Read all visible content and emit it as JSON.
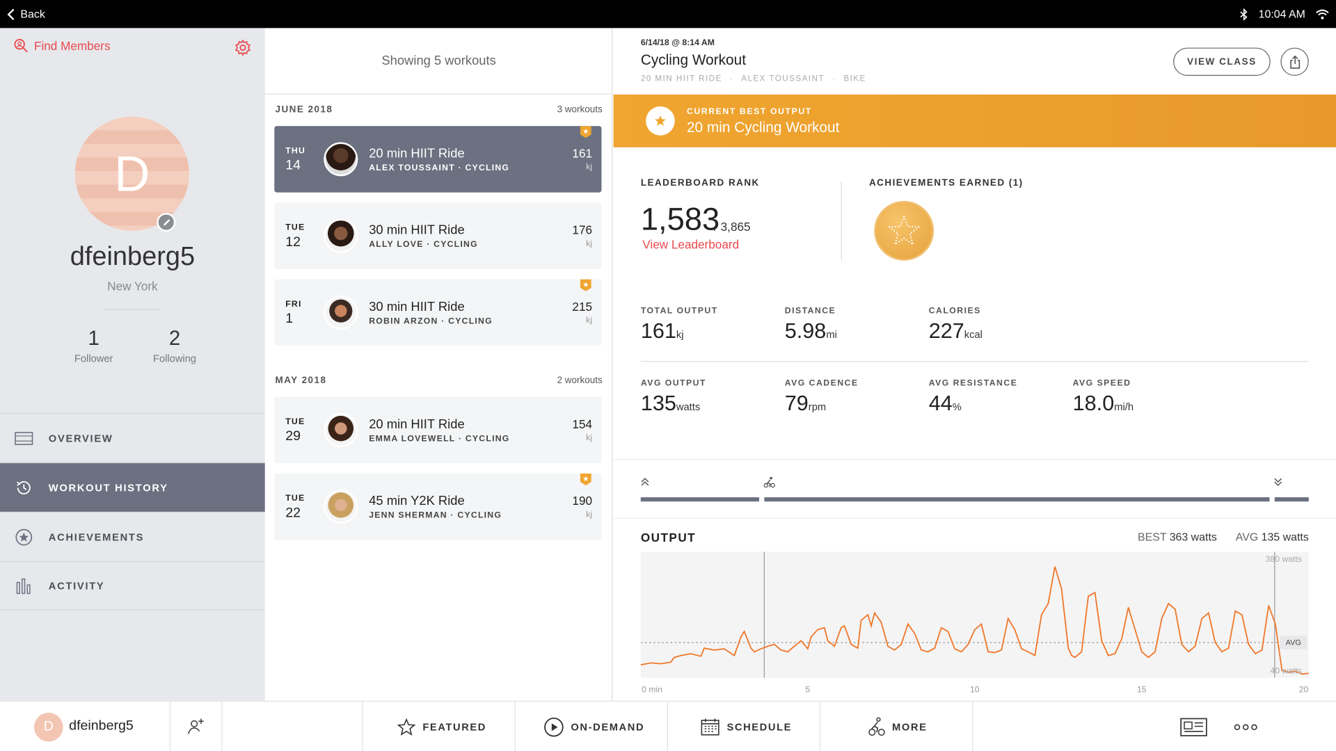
{
  "statusbar": {
    "back_label": "Back",
    "time": "10:04 AM"
  },
  "profile": {
    "find_members": "Find Members",
    "avatar_initial": "D",
    "username": "dfeinberg5",
    "location": "New York",
    "followers_count": "1",
    "followers_label": "Follower",
    "following_count": "2",
    "following_label": "Following"
  },
  "nav": {
    "overview": "OVERVIEW",
    "workout_history": "WORKOUT HISTORY",
    "achievements": "ACHIEVEMENTS",
    "activity": "ACTIVITY"
  },
  "history": {
    "header": "Showing 5 workouts",
    "months": [
      {
        "name": "JUNE 2018",
        "count": "3 workouts"
      },
      {
        "name": "MAY 2018",
        "count": "2 workouts"
      }
    ],
    "workouts": [
      {
        "day": "THU",
        "date": "14",
        "title": "20 min HIIT Ride",
        "instructor": "ALEX TOUSSAINT · CYCLING",
        "output": "161",
        "unit": "kj",
        "best": true,
        "selected": true
      },
      {
        "day": "TUE",
        "date": "12",
        "title": "30 min HIIT Ride",
        "instructor": "ALLY LOVE · CYCLING",
        "output": "176",
        "unit": "kj",
        "best": false,
        "selected": false
      },
      {
        "day": "FRI",
        "date": "1",
        "title": "30 min HIIT Ride",
        "instructor": "ROBIN ARZON · CYCLING",
        "output": "215",
        "unit": "kj",
        "best": true,
        "selected": false
      },
      {
        "day": "TUE",
        "date": "29",
        "title": "20 min HIIT Ride",
        "instructor": "EMMA LOVEWELL · CYCLING",
        "output": "154",
        "unit": "kj",
        "best": false,
        "selected": false
      },
      {
        "day": "TUE",
        "date": "22",
        "title": "45 min Y2K Ride",
        "instructor": "JENN SHERMAN · CYCLING",
        "output": "190",
        "unit": "kj",
        "best": true,
        "selected": false
      }
    ]
  },
  "detail": {
    "datetime": "6/14/18 @ 8:14 AM",
    "title": "Cycling Workout",
    "meta": [
      "20 MIN HIIT RIDE",
      "·",
      "ALEX TOUSSAINT",
      "·",
      "BIKE"
    ],
    "view_class": "VIEW CLASS",
    "best_label": "CURRENT BEST OUTPUT",
    "best_name": "20 min Cycling Workout",
    "leaderboard_label": "LEADERBOARD RANK",
    "rank": "1,583",
    "rank_total": "/ 3,865",
    "view_leaderboard": "View Leaderboard",
    "achievements_label": "ACHIEVEMENTS EARNED (1)",
    "metrics_row1": [
      {
        "label": "TOTAL OUTPUT",
        "value": "161",
        "unit": "kj"
      },
      {
        "label": "DISTANCE",
        "value": "5.98",
        "unit": "mi"
      },
      {
        "label": "CALORIES",
        "value": "227",
        "unit": "kcal"
      }
    ],
    "metrics_row2": [
      {
        "label": "AVG OUTPUT",
        "value": "135",
        "unit": "watts"
      },
      {
        "label": "AVG CADENCE",
        "value": "79",
        "unit": "rpm"
      },
      {
        "label": "AVG RESISTANCE",
        "value": "44",
        "unit": "%"
      },
      {
        "label": "AVG SPEED",
        "value": "18.0",
        "unit": "mi/h"
      }
    ],
    "output_label": "OUTPUT",
    "best_prefix": "BEST",
    "best_value": "363 watts",
    "avg_prefix": "AVG",
    "avg_value": "135 watts"
  },
  "chart_data": {
    "type": "line",
    "title": "OUTPUT",
    "x_unit": "min",
    "xlim": [
      0,
      20
    ],
    "ylim": [
      40,
      380
    ],
    "y_tick_labels": [
      "380 watts",
      "40 watts"
    ],
    "x_tick_labels": [
      "0 min",
      "5",
      "10",
      "15",
      "20"
    ],
    "avg_label": "AVG",
    "avg_value": 135,
    "best_value": 363,
    "color": "#f0782a",
    "series": [
      {
        "x": [
          0,
          0.3,
          0.6,
          0.9,
          1.0,
          1.2,
          1.5,
          1.8,
          1.9,
          2.2,
          2.5,
          2.8,
          3.0,
          3.1,
          3.3,
          3.4,
          3.6,
          3.8,
          4.0,
          4.2,
          4.4,
          4.6,
          4.8,
          5.0,
          5.1,
          5.3,
          5.5,
          5.6,
          5.8,
          6.0,
          6.1,
          6.3,
          6.5,
          6.6,
          6.8,
          6.9,
          7.0,
          7.2,
          7.4,
          7.6,
          7.8,
          8.0,
          8.2,
          8.4,
          8.6,
          8.8,
          9.0,
          9.2,
          9.4,
          9.6,
          9.8,
          10.0,
          10.2,
          10.4,
          10.6,
          10.8,
          11.0,
          11.2,
          11.4,
          11.6,
          11.8,
          12.0,
          12.2,
          12.4,
          12.6,
          12.8,
          12.9,
          13.0,
          13.2,
          13.4,
          13.6,
          13.8,
          14.0,
          14.2,
          14.4,
          14.6,
          14.8,
          15.0,
          15.2,
          15.4,
          15.6,
          15.8,
          16.0,
          16.2,
          16.4,
          16.6,
          16.8,
          17.0,
          17.2,
          17.4,
          17.6,
          17.8,
          18.0,
          18.2,
          18.4,
          18.6,
          18.8,
          19.0,
          19.2,
          19.4,
          19.6,
          19.8,
          20.0
        ],
        "y": [
          75,
          80,
          78,
          82,
          95,
          100,
          105,
          98,
          120,
          115,
          118,
          100,
          150,
          165,
          120,
          110,
          118,
          125,
          130,
          115,
          110,
          125,
          140,
          118,
          150,
          170,
          175,
          140,
          125,
          175,
          180,
          130,
          120,
          195,
          210,
          180,
          215,
          190,
          125,
          115,
          130,
          185,
          160,
          115,
          110,
          120,
          175,
          165,
          118,
          110,
          130,
          170,
          185,
          110,
          108,
          115,
          200,
          170,
          118,
          110,
          100,
          210,
          240,
          340,
          280,
          120,
          100,
          95,
          110,
          260,
          270,
          140,
          100,
          105,
          145,
          230,
          170,
          110,
          95,
          110,
          200,
          240,
          225,
          130,
          110,
          125,
          200,
          215,
          135,
          110,
          120,
          220,
          210,
          130,
          105,
          115,
          235,
          185,
          60,
          55,
          58,
          50,
          52
        ]
      }
    ]
  },
  "bottombar": {
    "avatar_initial": "D",
    "username": "dfeinberg5",
    "featured": "FEATURED",
    "ondemand": "ON-DEMAND",
    "schedule": "SCHEDULE",
    "more": "MORE"
  },
  "colors": {
    "accent": "#e94a4f",
    "orange": "#f0a530",
    "nav_active": "#6b7180",
    "chart_line": "#f0782a"
  }
}
